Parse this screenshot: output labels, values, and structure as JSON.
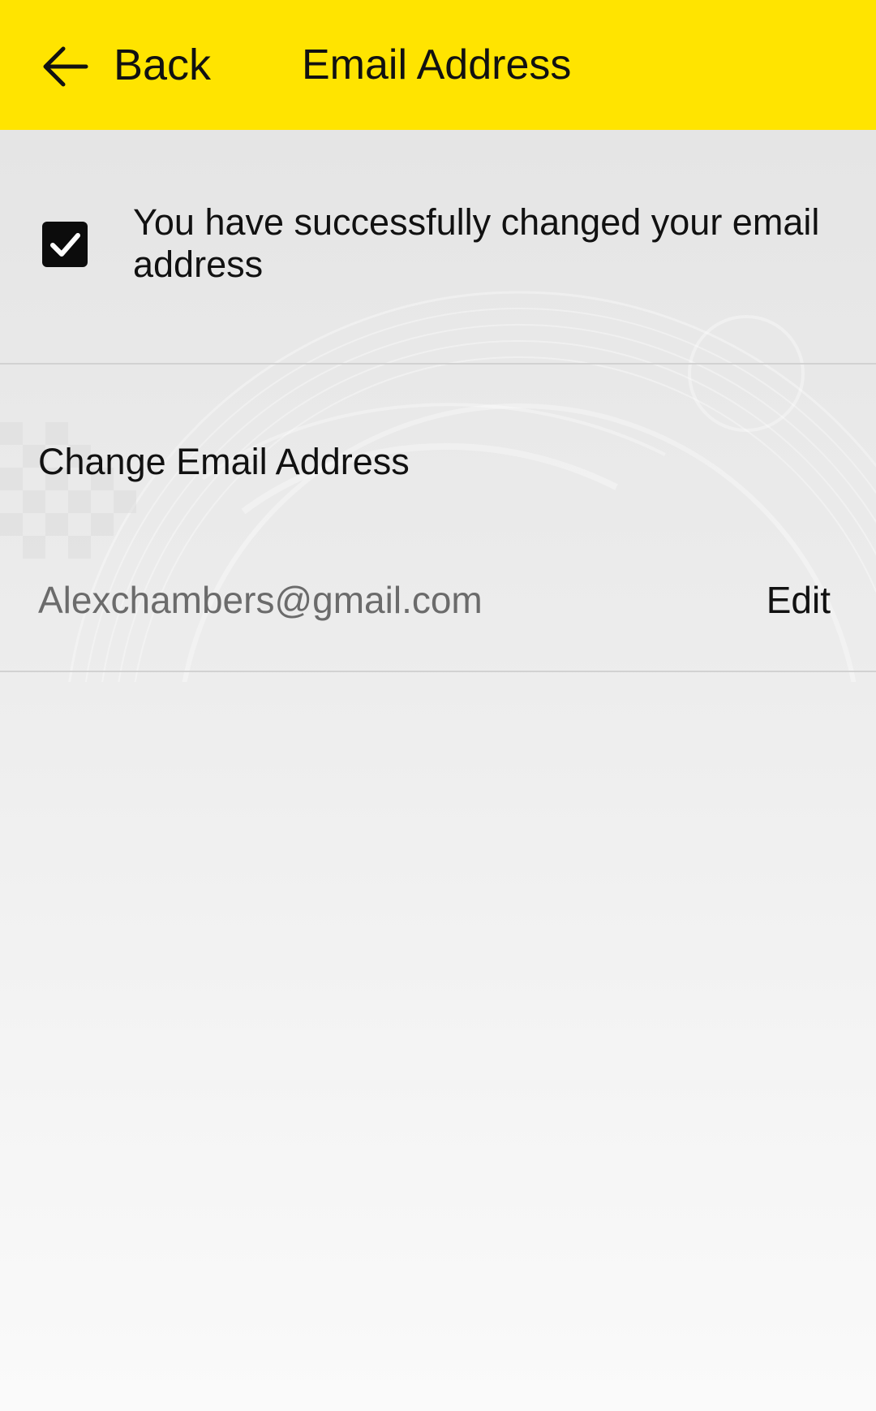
{
  "header": {
    "back_label": "Back",
    "title": "Email Address",
    "background_color": "#ffe400",
    "back_icon": "arrow-left-icon"
  },
  "success": {
    "message": "You have successfully changed your email address",
    "icon": "checkbox-checked-icon"
  },
  "email_section": {
    "heading": "Change Email Address",
    "email": "Alexchambers@gmail.com",
    "edit_label": "Edit"
  }
}
